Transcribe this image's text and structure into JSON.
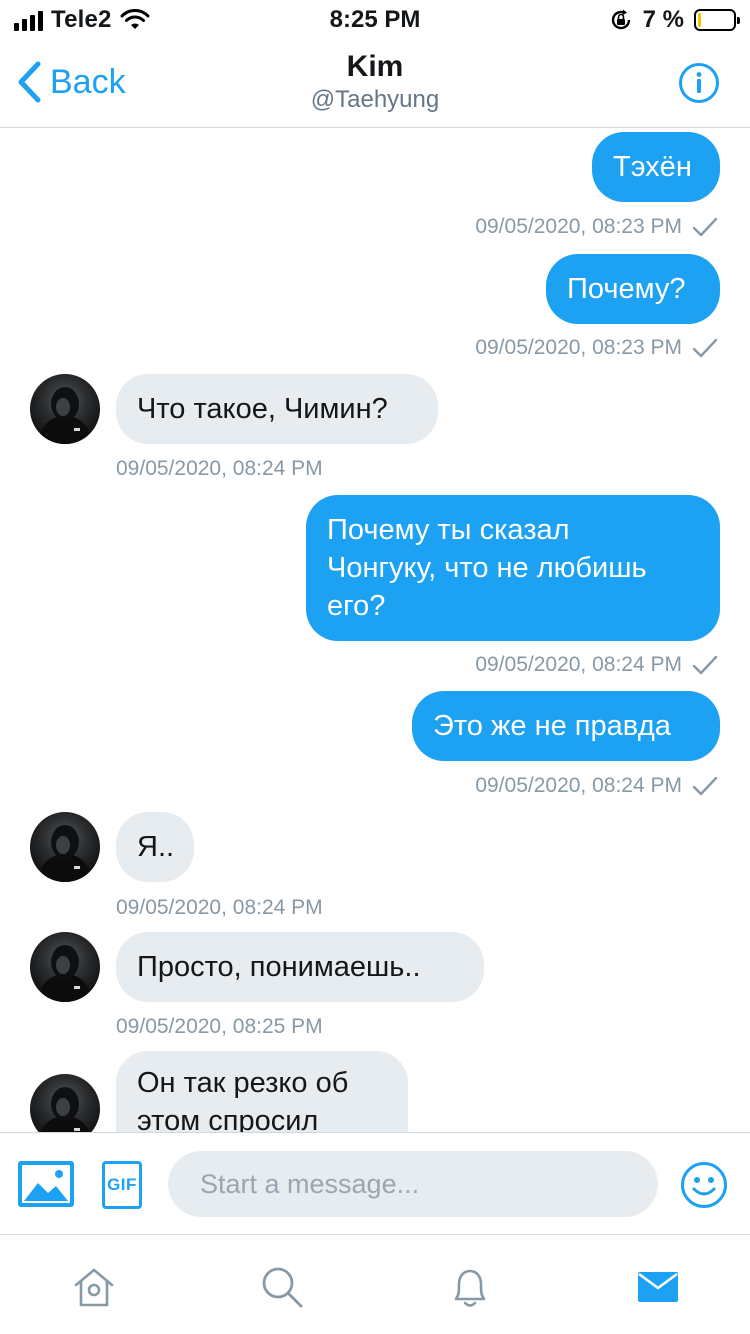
{
  "status_bar": {
    "carrier": "Tele2",
    "time": "8:25 PM",
    "battery_percent": "7 %",
    "battery_level": 0.07,
    "icons": [
      "signal-icon",
      "wifi-icon",
      "rotation-lock-icon",
      "battery-icon"
    ]
  },
  "header": {
    "back_label": "Back",
    "title": "Kim",
    "subtitle": "@Taehyung",
    "info_icon": "info-icon"
  },
  "messages": [
    {
      "direction": "out",
      "lines": [
        "Тэхён"
      ],
      "timestamp": "09/05/2020, 08:23 PM",
      "read_check": true
    },
    {
      "direction": "out",
      "lines": [
        "Почему?"
      ],
      "timestamp": "09/05/2020, 08:23 PM",
      "read_check": true
    },
    {
      "direction": "in",
      "lines": [
        "Что такое, Чимин?"
      ],
      "timestamp": "09/05/2020, 08:24 PM"
    },
    {
      "direction": "out",
      "lines": [
        "Почему ты сказал",
        "Чонгуку, что не любишь",
        "его?"
      ],
      "timestamp": "09/05/2020, 08:24 PM",
      "read_check": true
    },
    {
      "direction": "out",
      "lines": [
        "Это же не правда"
      ],
      "timestamp": "09/05/2020, 08:24 PM",
      "read_check": true
    },
    {
      "direction": "in",
      "lines": [
        "Я.."
      ],
      "timestamp": "09/05/2020, 08:24 PM"
    },
    {
      "direction": "in",
      "lines": [
        "Просто, понимаешь.."
      ],
      "timestamp": "09/05/2020, 08:25 PM"
    },
    {
      "direction": "in",
      "lines": [
        "Он так резко об",
        "этом спросил"
      ],
      "timestamp": ""
    }
  ],
  "composer": {
    "placeholder": "Start a message...",
    "gif_label": "GIF",
    "icons": [
      "image-icon",
      "gif-icon",
      "emoji-icon"
    ]
  },
  "tabbar": {
    "items": [
      "home-icon",
      "search-icon",
      "notifications-icon",
      "messages-icon"
    ],
    "active": "messages-icon"
  },
  "colors": {
    "accent": "#1da1f2",
    "incoming_bubble": "#e6ecf0",
    "timestamp": "#8899a6",
    "battery_low": "#f5c300"
  }
}
